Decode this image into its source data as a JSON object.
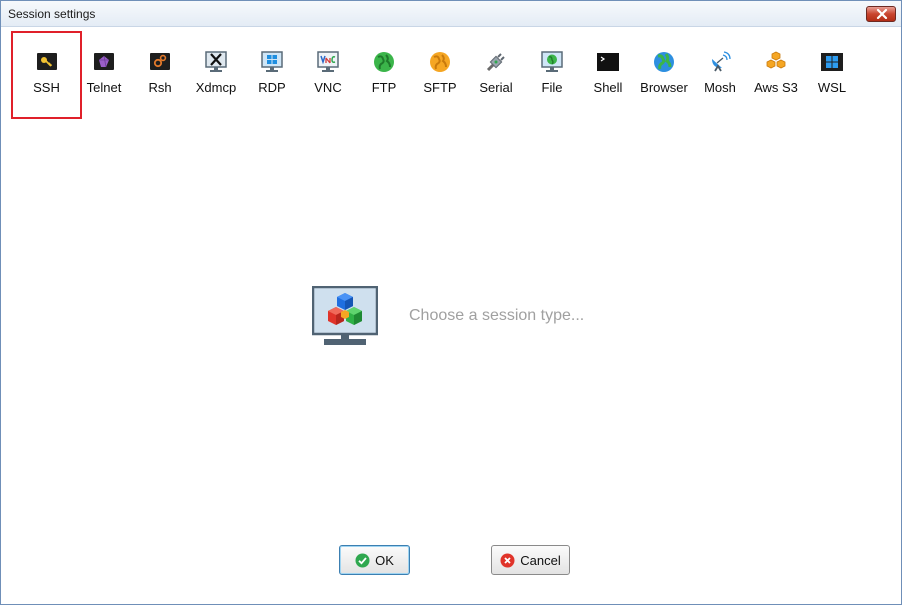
{
  "window": {
    "title": "Session settings",
    "close_icon": "close-icon"
  },
  "session_types": [
    {
      "id": "ssh",
      "label": "SSH",
      "icon": "key-icon",
      "selected": true
    },
    {
      "id": "telnet",
      "label": "Telnet",
      "icon": "telnet-icon",
      "selected": false
    },
    {
      "id": "rsh",
      "label": "Rsh",
      "icon": "rsh-icon",
      "selected": false
    },
    {
      "id": "xdmcp",
      "label": "Xdmcp",
      "icon": "x-monitor-icon",
      "selected": false
    },
    {
      "id": "rdp",
      "label": "RDP",
      "icon": "rdp-monitor-icon",
      "selected": false
    },
    {
      "id": "vnc",
      "label": "VNC",
      "icon": "vnc-monitor-icon",
      "selected": false
    },
    {
      "id": "ftp",
      "label": "FTP",
      "icon": "green-globe-icon",
      "selected": false
    },
    {
      "id": "sftp",
      "label": "SFTP",
      "icon": "orange-globe-icon",
      "selected": false
    },
    {
      "id": "serial",
      "label": "Serial",
      "icon": "serial-plug-icon",
      "selected": false
    },
    {
      "id": "file",
      "label": "File",
      "icon": "file-monitor-icon",
      "selected": false
    },
    {
      "id": "shell",
      "label": "Shell",
      "icon": "terminal-icon",
      "selected": false
    },
    {
      "id": "browser",
      "label": "Browser",
      "icon": "browser-globe-icon",
      "selected": false
    },
    {
      "id": "mosh",
      "label": "Mosh",
      "icon": "satellite-dish-icon",
      "selected": false
    },
    {
      "id": "awss3",
      "label": "Aws S3",
      "icon": "aws-cubes-icon",
      "selected": false
    },
    {
      "id": "wsl",
      "label": "WSL",
      "icon": "windows-logo-icon",
      "selected": false
    }
  ],
  "main": {
    "placeholder_text": "Choose a session type...",
    "placeholder_icon": "monitor-cubes-icon"
  },
  "buttons": {
    "ok_label": "OK",
    "ok_icon": "check-circle-icon",
    "cancel_label": "Cancel",
    "cancel_icon": "x-circle-icon"
  },
  "colors": {
    "selection_border": "#e0202a",
    "placeholder_text": "#a0a0a0"
  }
}
